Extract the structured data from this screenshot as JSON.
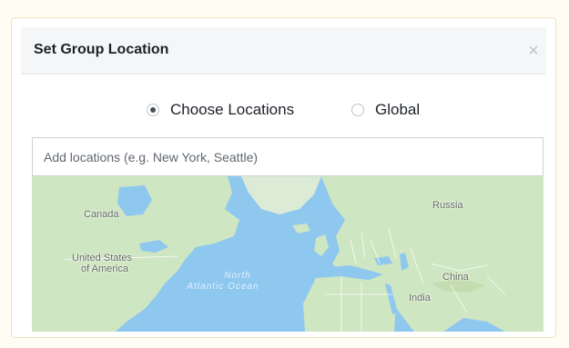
{
  "dialog": {
    "title": "Set Group Location",
    "close_icon": "×",
    "radio_options": [
      {
        "label": "Choose Locations",
        "checked": true
      },
      {
        "label": "Global",
        "checked": false
      }
    ],
    "search": {
      "placeholder": "Add locations (e.g. New York, Seattle)",
      "value": ""
    },
    "map": {
      "labels": {
        "canada": "Canada",
        "usa_line1": "United States",
        "usa_line2": "of America",
        "ocean_line1": "North",
        "ocean_line2": "Atlantic Ocean",
        "russia": "Russia",
        "china": "China",
        "india": "India"
      }
    }
  },
  "colors": {
    "land": "#cfe6c2",
    "water": "#8ec8ee",
    "page_background": "#fffdf3",
    "header_background": "#f5f6f7"
  }
}
